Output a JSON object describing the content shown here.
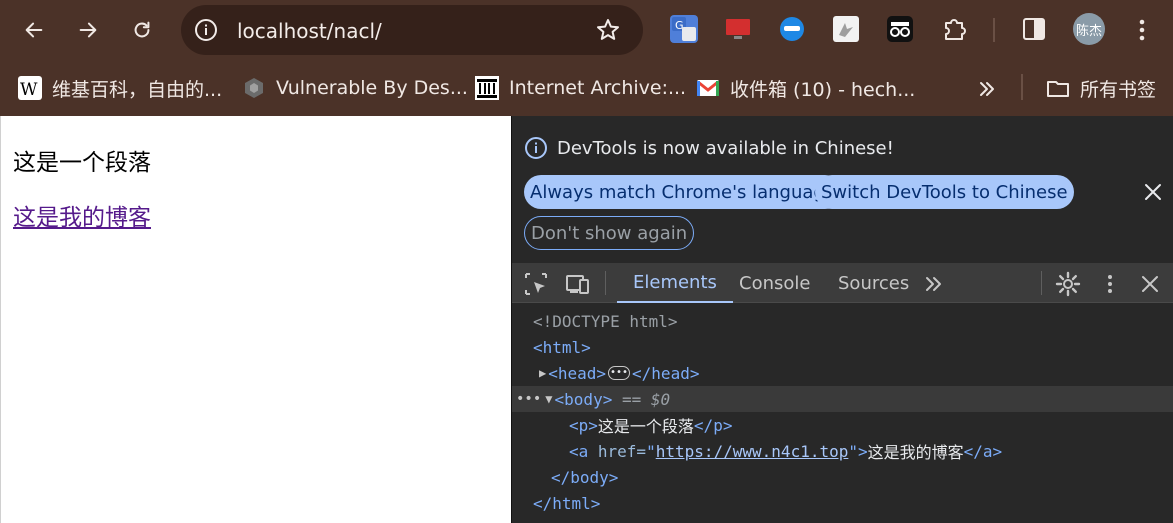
{
  "browser": {
    "url": "localhost/nacl/",
    "avatar_text": "陈杰",
    "bookmarks": [
      {
        "label": "维基百科，自由的...",
        "icon": "wikipedia-icon"
      },
      {
        "label": "Vulnerable By Des...",
        "icon": "vulnhub-icon"
      },
      {
        "label": "Internet Archive:...",
        "icon": "archive-icon"
      },
      {
        "label": "收件箱 (10) - hech...",
        "icon": "gmail-icon"
      }
    ],
    "bookmarks_folder": "所有书签"
  },
  "page": {
    "paragraph": "这是一个段落",
    "link": "这是我的博客"
  },
  "devtools": {
    "infobar": {
      "message": "DevTools is now available in Chinese!",
      "btn_match": "Always match Chrome's language",
      "btn_switch": "Switch DevTools to Chinese",
      "btn_dont_show": "Don't show again"
    },
    "tabs": {
      "elements": "Elements",
      "console": "Console",
      "sources": "Sources"
    },
    "dom": {
      "doctype": "<!DOCTYPE html>",
      "html_open": "<html>",
      "head_open": "<head>",
      "head_close": "</head>",
      "body_open": "<body>",
      "eq_ref": " == $0",
      "p_open": "<p>",
      "p_text": "这是一个段落",
      "p_close": "</p>",
      "a_open": "<a",
      "a_attr": " href=",
      "a_quote_open": "\"",
      "a_href": "https://www.n4c1.top",
      "a_quote_close": "\">",
      "a_text": "这是我的博客",
      "a_close": "</a>",
      "body_close": "</body>",
      "html_close": "</html>"
    }
  },
  "colors": {
    "chrome_bg": "#4b3228",
    "devtools_bg": "#282828",
    "accent": "#a8c7fa",
    "link_visited": "#551a8b"
  }
}
